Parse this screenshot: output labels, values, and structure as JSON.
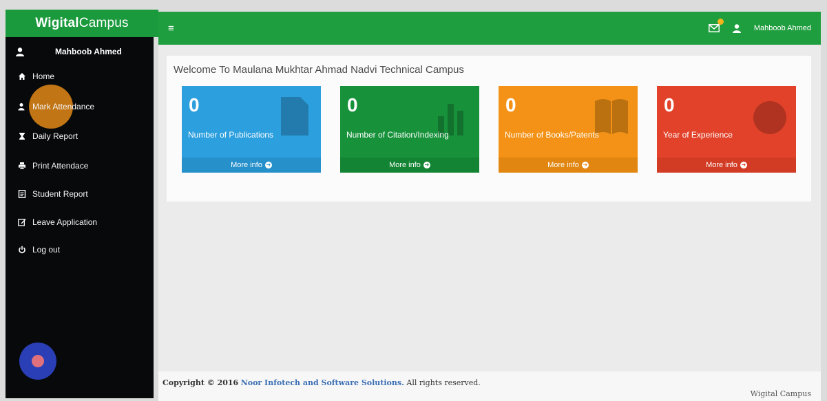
{
  "brand": {
    "bold": "Wigital",
    "light": "Campus"
  },
  "topbar": {
    "menu_icon": "hamburger-icon",
    "mail_icon": "envelope-icon",
    "mail_badge": "",
    "user_icon": "user-icon",
    "user_name": "Mahboob Ahmed"
  },
  "sidebar": {
    "user_name": "Mahboob Ahmed",
    "items": [
      {
        "label": "Home",
        "icon": "home-icon"
      },
      {
        "label": "Mark Attendance",
        "icon": "user-check-icon"
      },
      {
        "label": "Daily Report",
        "icon": "hourglass-icon"
      },
      {
        "label": "Print Attendace",
        "icon": "print-icon"
      },
      {
        "label": "Student Report",
        "icon": "report-icon"
      },
      {
        "label": "Leave Application",
        "icon": "edit-icon"
      },
      {
        "label": "Log out",
        "icon": "power-icon"
      }
    ]
  },
  "main": {
    "welcome": "Welcome To Maulana Mukhtar Ahmad Nadvi Technical Campus",
    "cards": [
      {
        "value": "0",
        "label": "Number of Publications",
        "link": "More info",
        "color": "#2c9fde",
        "footer_color": "#2690cb",
        "icon": "document-icon"
      },
      {
        "value": "0",
        "label": "Number of Citation/Indexing",
        "link": "More info",
        "color": "#17923b",
        "footer_color": "#138433",
        "icon": "bar-chart-icon"
      },
      {
        "value": "0",
        "label": "Number of Books/Patents",
        "link": "More info",
        "color": "#f39216",
        "footer_color": "#e08611",
        "icon": "book-icon"
      },
      {
        "value": "0",
        "label": "Year of Experience",
        "link": "More info",
        "color": "#e2422a",
        "footer_color": "#d23b24",
        "icon": "pie-chart-icon"
      }
    ]
  },
  "footer": {
    "copyright_prefix": "Copyright © 2016",
    "company": "Noor Infotech and Software Solutions.",
    "rights": "All rights reserved.",
    "right_text": "Wigital Campus"
  }
}
